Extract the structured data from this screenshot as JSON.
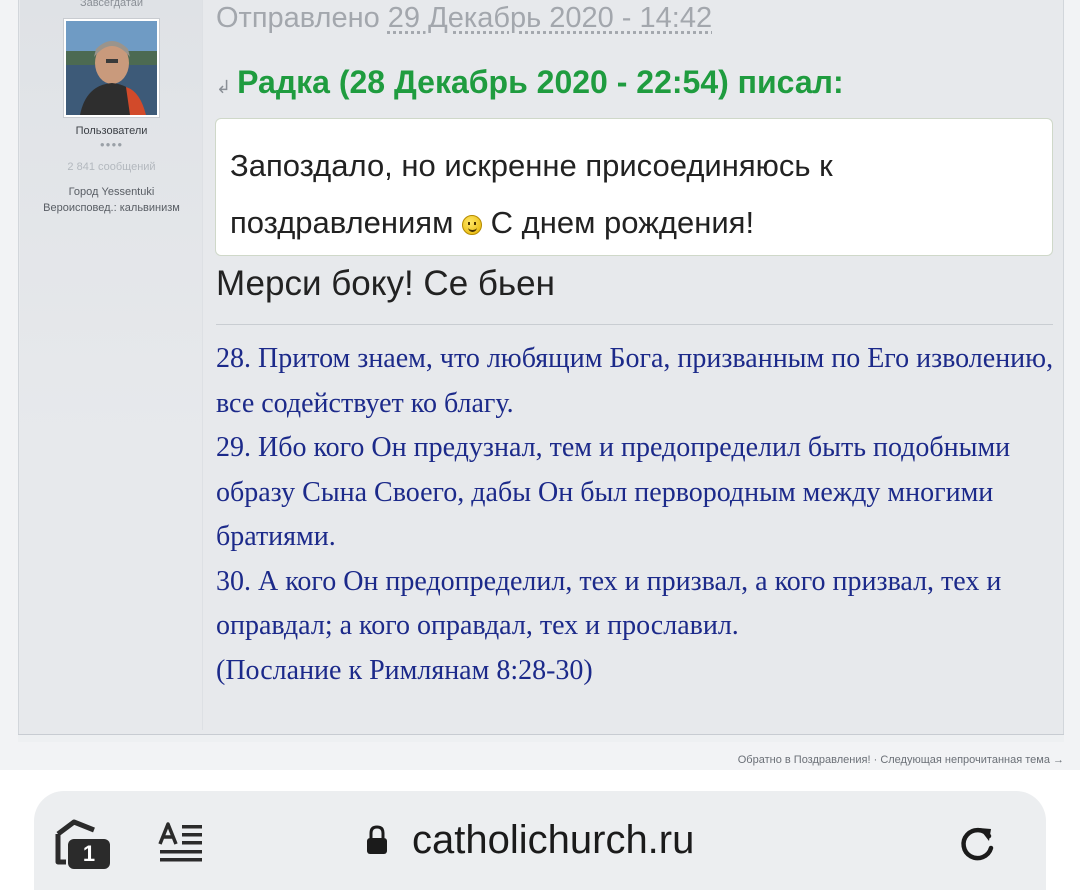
{
  "author": {
    "name_partial": "Завсегдатай",
    "group": "Пользователи",
    "pips": "●●●●",
    "posts": "2 841 сообщений",
    "city_label": "Город",
    "city_value": "Yessentuki",
    "faith_label": "Вероисповед.:",
    "faith_value": "кальвинизм"
  },
  "post": {
    "sent_label": "Отправлено",
    "sent_date": "29 Декабрь 2020 - 14:42",
    "quote_header": "Радка (28 Декабрь 2020 - 22:54) писал:",
    "quote_line1": "Запоздало, но искренне присоединяюсь к",
    "quote_line2a": "поздравлениям",
    "quote_line2b": "С днем рождения!",
    "reply": "Мерси боку! Се бьен",
    "signature": [
      "28. Притом знаем, что любящим Бога, призванным по Его изволению, все содействует ко благу.",
      "29. Ибо кого Он предузнал, тем и предопределил быть подобными образу Сына Своего, дабы Он был первородным между многими братиями.",
      "30. А кого Он предопределил, тех и призвал, а кого призвал, тех и оправдал; а кого оправдал, тех и прославил.",
      "(Послание к Римлянам 8:28-30)"
    ]
  },
  "footer": {
    "back_link": "Обратно в Поздравления!",
    "separator": "·",
    "next_link": "Следующая непрочитанная тема →"
  },
  "browser": {
    "url": "catholichurch.ru",
    "tab_count": "1"
  }
}
